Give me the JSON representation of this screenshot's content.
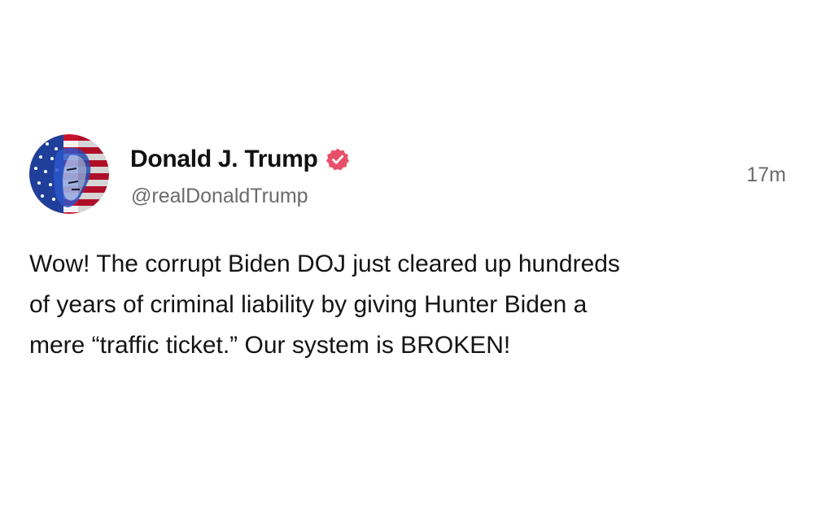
{
  "post": {
    "author": {
      "display_name": "Donald J. Trump",
      "handle": "@realDonaldTrump",
      "verified": true,
      "avatar_icon": "flag-portrait-avatar"
    },
    "timestamp": "17m",
    "body_lines": [
      "Wow! The corrupt Biden DOJ just cleared up hundreds",
      "of years of criminal liability by giving Hunter Biden a",
      "mere “traffic ticket.” Our system is BROKEN!"
    ]
  },
  "colors": {
    "background": "#ffffff",
    "text_primary": "#111111",
    "text_secondary": "#6b6b6b",
    "verified_badge": "#e8506a"
  }
}
